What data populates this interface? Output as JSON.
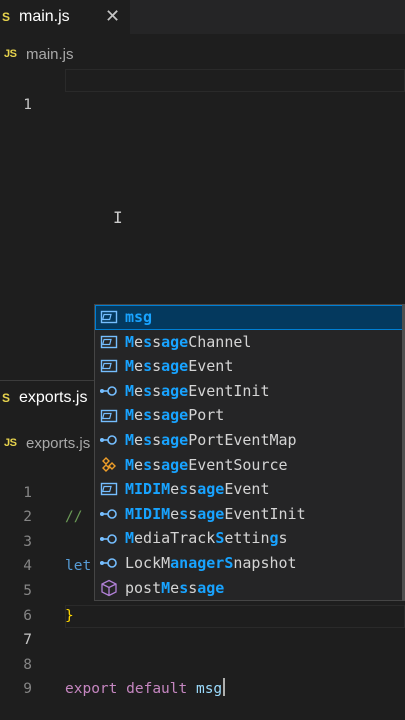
{
  "top_pane": {
    "tab": {
      "badge": "S",
      "label": "main.js",
      "close": "✕"
    },
    "breadcrumb": {
      "badge": "JS",
      "label": "main.js"
    },
    "lines": [
      {
        "number": "1"
      }
    ]
  },
  "bottom_pane": {
    "tab": {
      "badge": "S",
      "label": "exports.js"
    },
    "breadcrumb": {
      "badge": "JS",
      "label": "exports.js"
    },
    "lines": [
      {
        "number": "1",
        "code": "//"
      },
      {
        "number": "2",
        "code": ""
      },
      {
        "number": "3",
        "code": "let"
      },
      {
        "number": "4",
        "code": ""
      },
      {
        "number": "5",
        "code": "}"
      },
      {
        "number": "6",
        "code": ""
      },
      {
        "number": "7",
        "kw1": "export",
        "kw2": "default",
        "ident": "msg"
      },
      {
        "number": "8",
        "code": ""
      },
      {
        "number": "9",
        "code": ""
      }
    ]
  },
  "cursor": {
    "ibeam": "I"
  },
  "suggestions": [
    {
      "kind": "variable",
      "parts": [
        {
          "t": "msg",
          "m": true
        }
      ]
    },
    {
      "kind": "variable",
      "parts": [
        {
          "t": "M",
          "m": true
        },
        {
          "t": "e",
          "m": false
        },
        {
          "t": "s",
          "m": true
        },
        {
          "t": "s",
          "m": false
        },
        {
          "t": "age",
          "m": true
        },
        {
          "t": "Channel",
          "m": false
        }
      ]
    },
    {
      "kind": "variable",
      "parts": [
        {
          "t": "M",
          "m": true
        },
        {
          "t": "e",
          "m": false
        },
        {
          "t": "s",
          "m": true
        },
        {
          "t": "s",
          "m": false
        },
        {
          "t": "age",
          "m": true
        },
        {
          "t": "Event",
          "m": false
        }
      ]
    },
    {
      "kind": "interface",
      "parts": [
        {
          "t": "M",
          "m": true
        },
        {
          "t": "e",
          "m": false
        },
        {
          "t": "s",
          "m": true
        },
        {
          "t": "s",
          "m": false
        },
        {
          "t": "age",
          "m": true
        },
        {
          "t": "EventInit",
          "m": false
        }
      ]
    },
    {
      "kind": "variable",
      "parts": [
        {
          "t": "M",
          "m": true
        },
        {
          "t": "e",
          "m": false
        },
        {
          "t": "s",
          "m": true
        },
        {
          "t": "s",
          "m": false
        },
        {
          "t": "age",
          "m": true
        },
        {
          "t": "Port",
          "m": false
        }
      ]
    },
    {
      "kind": "interface",
      "parts": [
        {
          "t": "M",
          "m": true
        },
        {
          "t": "e",
          "m": false
        },
        {
          "t": "s",
          "m": true
        },
        {
          "t": "s",
          "m": false
        },
        {
          "t": "age",
          "m": true
        },
        {
          "t": "PortEventMap",
          "m": false
        }
      ]
    },
    {
      "kind": "class",
      "parts": [
        {
          "t": "M",
          "m": true
        },
        {
          "t": "e",
          "m": false
        },
        {
          "t": "s",
          "m": true
        },
        {
          "t": "s",
          "m": false
        },
        {
          "t": "age",
          "m": true
        },
        {
          "t": "EventSource",
          "m": false
        }
      ]
    },
    {
      "kind": "variable",
      "parts": [
        {
          "t": "MIDIM",
          "m": true
        },
        {
          "t": "e",
          "m": false
        },
        {
          "t": "s",
          "m": true
        },
        {
          "t": "s",
          "m": false
        },
        {
          "t": "age",
          "m": true
        },
        {
          "t": "Event",
          "m": false
        }
      ]
    },
    {
      "kind": "interface",
      "parts": [
        {
          "t": "MIDIM",
          "m": true
        },
        {
          "t": "e",
          "m": false
        },
        {
          "t": "s",
          "m": true
        },
        {
          "t": "s",
          "m": false
        },
        {
          "t": "age",
          "m": true
        },
        {
          "t": "EventInit",
          "m": false
        }
      ]
    },
    {
      "kind": "interface",
      "parts": [
        {
          "t": "M",
          "m": true
        },
        {
          "t": "ediaTrack",
          "m": false
        },
        {
          "t": "S",
          "m": true
        },
        {
          "t": "ettin",
          "m": false
        },
        {
          "t": "g",
          "m": true
        },
        {
          "t": "s",
          "m": false
        }
      ]
    },
    {
      "kind": "interface",
      "parts": [
        {
          "t": "LockM",
          "m": false
        },
        {
          "t": "anager",
          "m": true
        },
        {
          "t": "S",
          "m": true
        },
        {
          "t": "napshot",
          "m": false
        }
      ]
    },
    {
      "kind": "method",
      "parts": [
        {
          "t": "post",
          "m": false
        },
        {
          "t": "M",
          "m": true
        },
        {
          "t": "e",
          "m": false
        },
        {
          "t": "s",
          "m": true
        },
        {
          "t": "s",
          "m": false
        },
        {
          "t": "age",
          "m": true
        }
      ]
    }
  ],
  "colors": {
    "accent": "#18a3ff",
    "js_badge": "#e8d44d",
    "selected_row": "#04395e"
  }
}
